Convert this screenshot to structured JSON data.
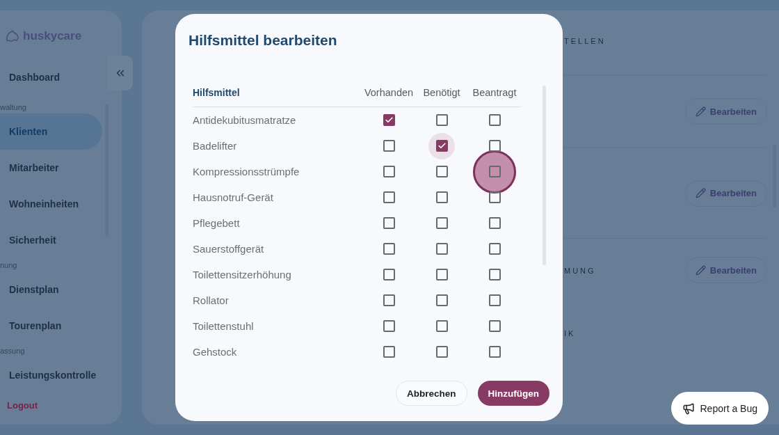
{
  "sidebar": {
    "logo": "huskycare",
    "items": [
      {
        "kind": "item",
        "label": "Dashboard",
        "selected": false
      },
      {
        "kind": "section",
        "label": "waltung"
      },
      {
        "kind": "item",
        "label": "Klienten",
        "selected": true
      },
      {
        "kind": "item",
        "label": "Mitarbeiter",
        "selected": false
      },
      {
        "kind": "item",
        "label": "Wohneinheiten",
        "selected": false
      },
      {
        "kind": "item",
        "label": "Sicherheit",
        "selected": false
      },
      {
        "kind": "section",
        "label": "nung"
      },
      {
        "kind": "item",
        "label": "Dienstplan",
        "selected": false
      },
      {
        "kind": "item",
        "label": "Tourenplan",
        "selected": false
      },
      {
        "kind": "section",
        "label": "assung"
      },
      {
        "kind": "item",
        "label": "Leistungskontrolle",
        "selected": false
      }
    ],
    "logout": "Logout"
  },
  "main": {
    "sections": [
      {
        "label": "TELLEN"
      },
      {
        "button": "Bearbeiten"
      },
      {
        "button": "Bearbeiten"
      },
      {
        "label": "MUNG",
        "button": "Bearbeiten"
      },
      {
        "label": "IK"
      }
    ]
  },
  "dialog": {
    "title": "Hilfsmittel bearbeiten",
    "columns": [
      "Hilfsmittel",
      "Vorhanden",
      "Benötigt",
      "Beantragt"
    ],
    "rows": [
      {
        "name": "Antidekubitusmatratze",
        "checks": [
          {
            "checked": true
          },
          {
            "checked": false
          },
          {
            "checked": false
          }
        ]
      },
      {
        "name": "Badelifter",
        "checks": [
          {
            "checked": false
          },
          {
            "checked": true,
            "focused": true
          },
          {
            "checked": false
          }
        ]
      },
      {
        "name": "Kompressionsstrümpfe",
        "checks": [
          {
            "checked": false
          },
          {
            "checked": false
          },
          {
            "checked": false,
            "touched": true
          }
        ]
      },
      {
        "name": "Hausnotruf-Gerät",
        "checks": [
          {
            "checked": false
          },
          {
            "checked": false
          },
          {
            "checked": false
          }
        ]
      },
      {
        "name": "Pflegebett",
        "checks": [
          {
            "checked": false
          },
          {
            "checked": false
          },
          {
            "checked": false
          }
        ]
      },
      {
        "name": "Sauerstoffgerät",
        "checks": [
          {
            "checked": false
          },
          {
            "checked": false
          },
          {
            "checked": false
          }
        ]
      },
      {
        "name": "Toilettensitzerhöhung",
        "checks": [
          {
            "checked": false
          },
          {
            "checked": false
          },
          {
            "checked": false
          }
        ]
      },
      {
        "name": "Rollator",
        "checks": [
          {
            "checked": false
          },
          {
            "checked": false
          },
          {
            "checked": false
          }
        ]
      },
      {
        "name": "Toilettenstuhl",
        "checks": [
          {
            "checked": false
          },
          {
            "checked": false
          },
          {
            "checked": false
          }
        ]
      },
      {
        "name": "Gehstock",
        "checks": [
          {
            "checked": false
          },
          {
            "checked": false
          },
          {
            "checked": false
          }
        ]
      }
    ],
    "buttons": [
      {
        "kind": "secondary",
        "label": "Abbrechen"
      },
      {
        "kind": "primary",
        "label": "Hinzufügen"
      }
    ]
  },
  "report_button": "Report a Bug"
}
